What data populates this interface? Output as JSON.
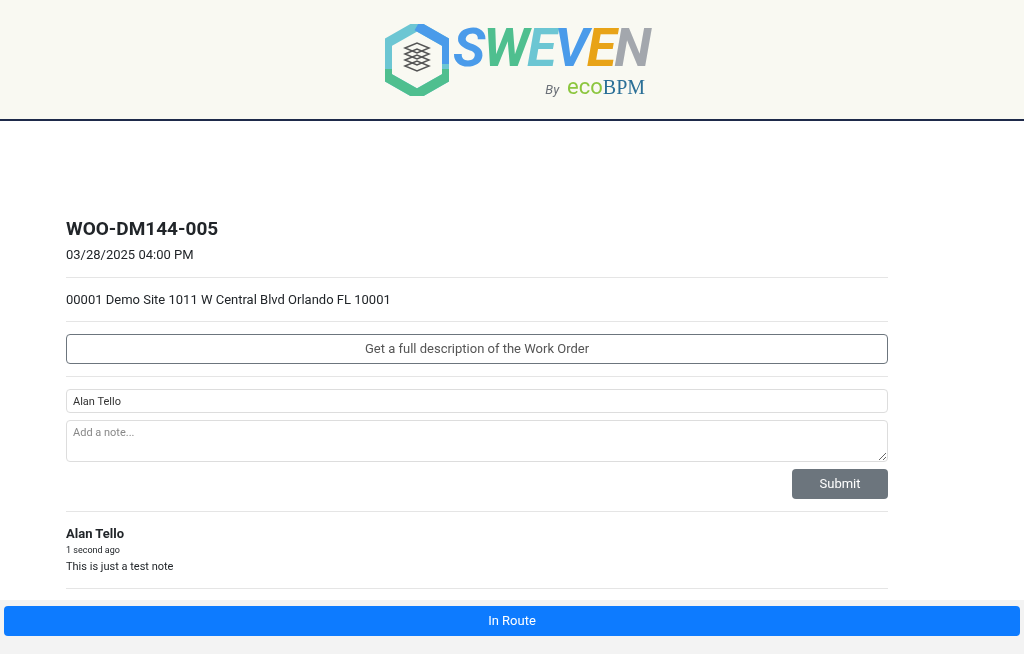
{
  "logo": {
    "letters": [
      {
        "text": "S",
        "color": "#4a9bea"
      },
      {
        "text": "W",
        "color": "#4fbf8f"
      },
      {
        "text": "E",
        "color": "#6cc6d3"
      },
      {
        "text": "V",
        "color": "#4a9bea"
      },
      {
        "text": "E",
        "color": "#e8a317"
      },
      {
        "text": "N",
        "color": "#a3a7ad"
      }
    ],
    "by": "By",
    "eco": "eco",
    "bpm": "BPM"
  },
  "work_order": {
    "title": "WOO-DM144-005",
    "date": "03/28/2025 04:00 PM",
    "address": "00001 Demo Site 1011 W Central Blvd Orlando FL 10001",
    "description_button": "Get a full description of the Work Order"
  },
  "note_form": {
    "name": "Alan Tello",
    "placeholder": "Add a note...",
    "submit": "Submit"
  },
  "notes": [
    {
      "author": "Alan Tello",
      "time": "1 second ago",
      "text": "This is just a test note"
    }
  ],
  "footer_button": "In Route"
}
